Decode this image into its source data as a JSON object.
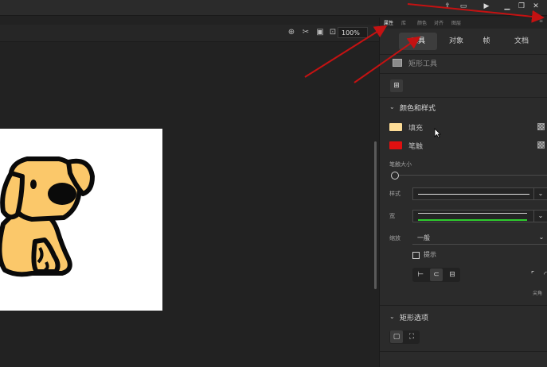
{
  "toolbar": {
    "zoom_value": "100%"
  },
  "panel": {
    "tabs": [
      "属性",
      "库",
      "颜色",
      "对齐",
      "图层"
    ],
    "segments": [
      "工具",
      "对象",
      "帧",
      "文档"
    ],
    "active_tool_label": "矩形工具",
    "color_section_title": "颜色和样式",
    "fill_label": "填充",
    "stroke_label": "笔触",
    "fill_color": "#fddc96",
    "stroke_color": "#e01010",
    "stroke_size_label": "笔触大小",
    "style_label": "样式",
    "width_label": "宽",
    "scale_label": "缩放",
    "scale_value": "一般",
    "hint_label": "提示",
    "join_label": "尖角",
    "rect_section_title": "矩形选项"
  },
  "colors": {
    "arrow_red": "#c41212",
    "width_profile_green": "#2ecc2e",
    "dog_fill": "#fbc86a"
  }
}
